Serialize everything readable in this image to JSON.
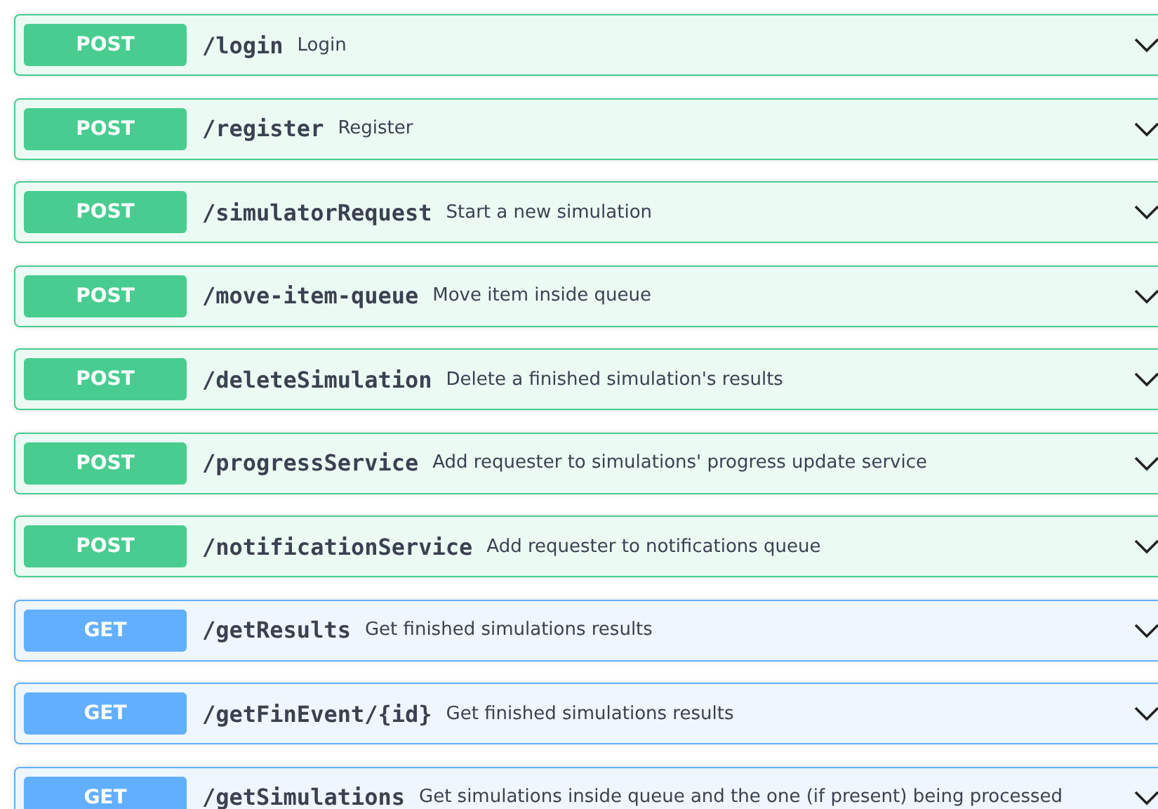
{
  "operations": [
    {
      "method": "POST",
      "path": "/login",
      "summary": "Login",
      "expanded": false
    },
    {
      "method": "POST",
      "path": "/register",
      "summary": "Register",
      "expanded": false
    },
    {
      "method": "POST",
      "path": "/simulatorRequest",
      "summary": "Start a new simulation",
      "expanded": false
    },
    {
      "method": "POST",
      "path": "/move-item-queue",
      "summary": "Move item inside queue",
      "expanded": false
    },
    {
      "method": "POST",
      "path": "/deleteSimulation",
      "summary": "Delete a finished simulation's results",
      "expanded": false
    },
    {
      "method": "POST",
      "path": "/progressService",
      "summary": "Add requester to simulations' progress update service",
      "expanded": false
    },
    {
      "method": "POST",
      "path": "/notificationService",
      "summary": "Add requester to notifications queue",
      "expanded": false
    },
    {
      "method": "GET",
      "path": "/getResults",
      "summary": "Get finished simulations results",
      "expanded": false
    },
    {
      "method": "GET",
      "path": "/getFinEvent/{id}",
      "summary": "Get finished simulations results",
      "expanded": false
    },
    {
      "method": "GET",
      "path": "/getSimulations",
      "summary": "Get simulations inside queue and the one (if present) being processed",
      "expanded": false
    }
  ]
}
